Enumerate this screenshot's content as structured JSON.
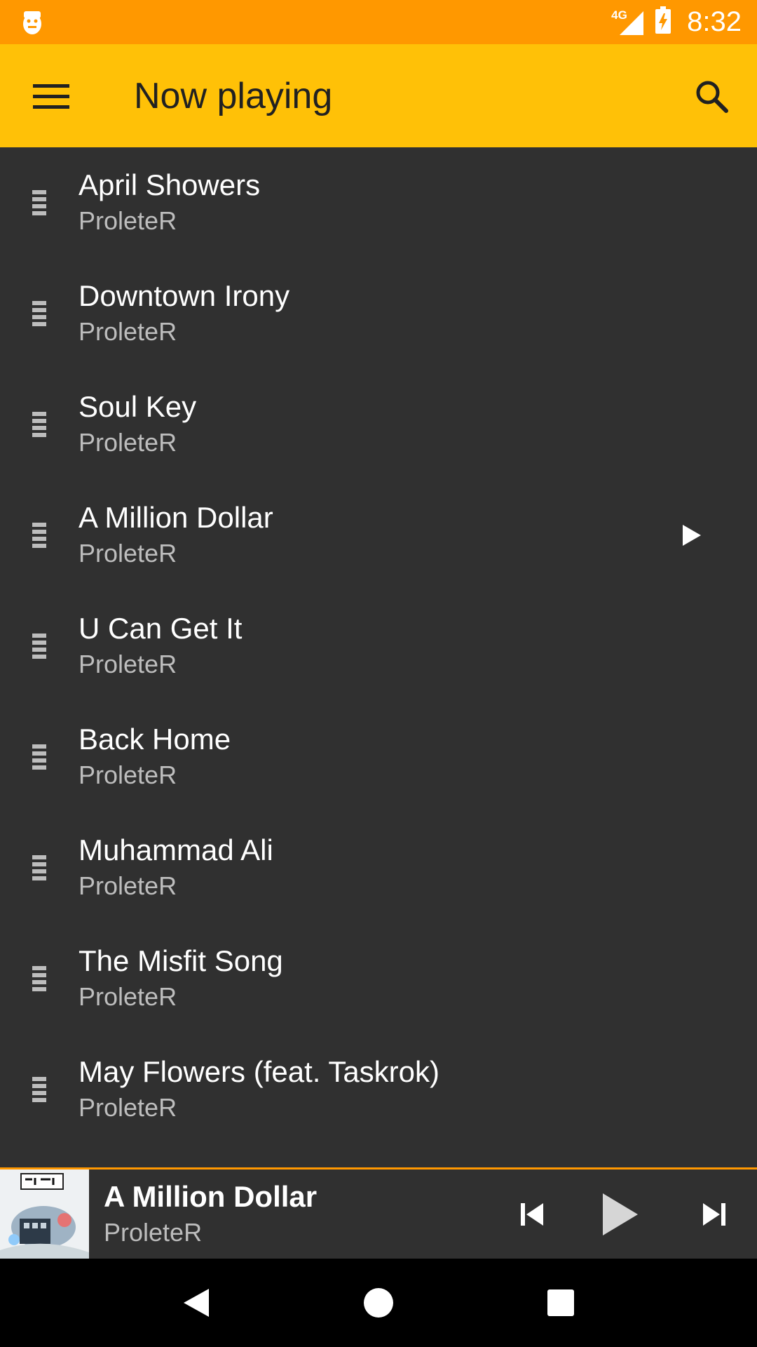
{
  "status_bar": {
    "time": "8:32",
    "network": "4G",
    "icons": [
      "app-notification-icon",
      "signal-icon",
      "battery-charging-icon"
    ],
    "color": "#ff9800"
  },
  "app_bar": {
    "title": "Now playing",
    "icons": [
      "menu-icon",
      "search-icon"
    ],
    "color": "#ffc107"
  },
  "queue": {
    "background": "#303030",
    "items": [
      {
        "title": "April Showers",
        "artist": "ProleteR"
      },
      {
        "title": "Downtown Irony",
        "artist": "ProleteR"
      },
      {
        "title": "Soul Key",
        "artist": "ProleteR"
      },
      {
        "title": "A Million Dollar",
        "artist": "ProleteR",
        "playing": true
      },
      {
        "title": "U Can Get It",
        "artist": "ProleteR"
      },
      {
        "title": "Back Home",
        "artist": "ProleteR"
      },
      {
        "title": "Muhammad Ali",
        "artist": "ProleteR"
      },
      {
        "title": "The Misfit Song",
        "artist": "ProleteR"
      },
      {
        "title": "May Flowers (feat. Taskrok)",
        "artist": "ProleteR"
      }
    ]
  },
  "mini_player": {
    "title": "A Million Dollar",
    "artist": "ProleteR",
    "accent": "#ff9800",
    "controls": [
      "skip-previous-icon",
      "play-icon",
      "skip-next-icon"
    ]
  },
  "nav_bar": {
    "icons": [
      "back-icon",
      "home-icon",
      "recents-icon"
    ]
  }
}
